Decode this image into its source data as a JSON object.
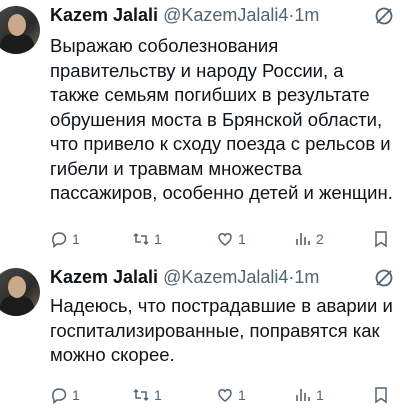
{
  "tweets": [
    {
      "name": "Kazem Jalali",
      "handle": "@KazemJalali4",
      "separator": "·",
      "time": "1m",
      "lines": [
        "Выражаю соболезнования",
        "правительству и народу России, а",
        "также семьям погибших в результате",
        "обрушения моста в Брянской области,",
        "что привело к сходу поезда с рельсов и",
        "гибели и травмам множества",
        "пассажиров, особенно детей и женщин."
      ],
      "replies": "1",
      "retweets": "1",
      "likes": "1",
      "views": "2"
    },
    {
      "name": "Kazem Jalali",
      "handle": "@KazemJalali4",
      "separator": "·",
      "time": "1m",
      "lines": [
        "Надеюсь, что пострадавшие в аварии и",
        "госпитализированные, поправятся как",
        "можно скорее."
      ],
      "replies": "1",
      "retweets": "1",
      "likes": "1",
      "views": "1"
    }
  ],
  "icons": {
    "more": "grok-slash-icon",
    "reply": "reply-icon",
    "retweet": "retweet-icon",
    "like": "like-icon",
    "views": "views-icon",
    "bookmark": "bookmark-icon"
  }
}
